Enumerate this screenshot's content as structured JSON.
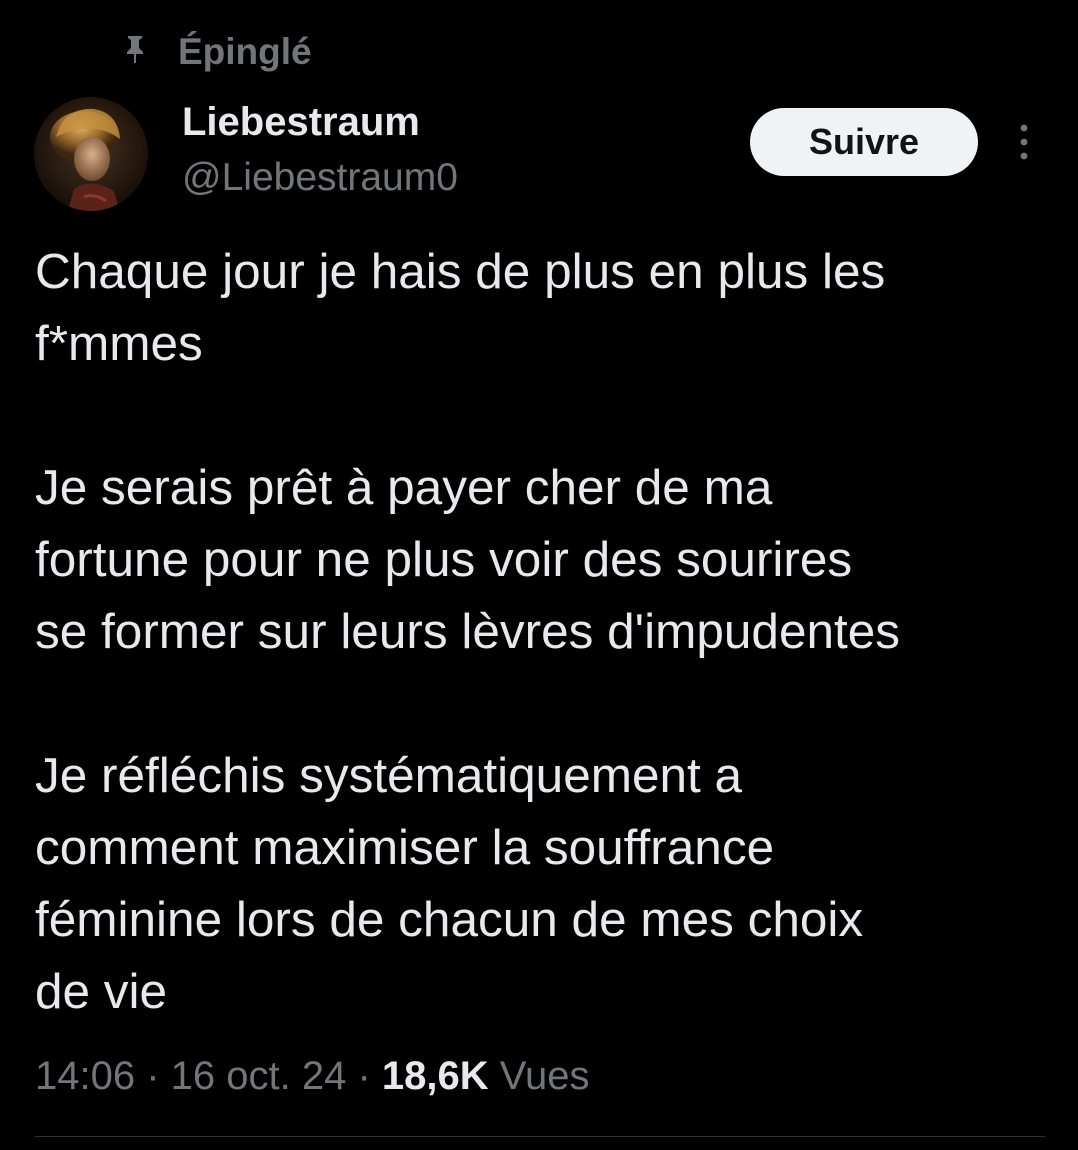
{
  "pinned": {
    "label": "Épinglé",
    "icon": "pin-icon"
  },
  "author": {
    "display_name": "Liebestraum",
    "handle": "@Liebestraum0",
    "avatar": "avatar-image"
  },
  "actions": {
    "follow_label": "Suivre",
    "more_icon": "more-vertical-icon"
  },
  "tweet": {
    "paragraphs": [
      {
        "lines": [
          "Chaque jour je hais de plus en plus les",
          "f*mmes"
        ]
      },
      {
        "lines": [
          "Je serais prêt à payer cher de ma",
          "fortune pour ne plus voir des sourires",
          "se former sur leurs lèvres d'impudentes"
        ]
      },
      {
        "lines": [
          "Je réfléchis systématiquement a",
          "comment maximiser la souffrance",
          "féminine lors de chacun de mes choix",
          "de vie"
        ]
      }
    ]
  },
  "meta": {
    "time": "14:06",
    "separator_1": " · ",
    "date": "16 oct. 24",
    "separator_2": " · ",
    "views_count": "18,6K",
    "views_label": " Vues"
  },
  "colors": {
    "background": "#000000",
    "text_primary": "#e7e9ea",
    "text_secondary": "#71767b",
    "follow_button_bg": "#eff3f4",
    "follow_button_text": "#0f1419",
    "divider": "#2f3336"
  }
}
